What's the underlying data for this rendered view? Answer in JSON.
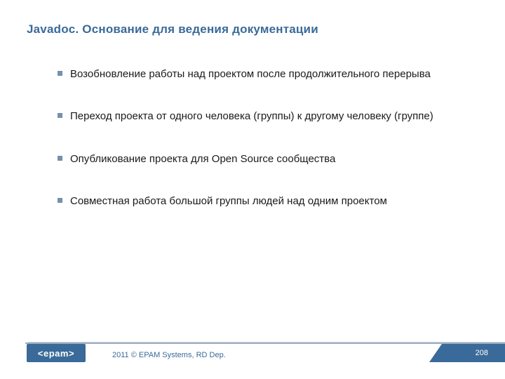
{
  "title": "Javadoc. Основание для ведения документации",
  "bullets": [
    "Возобновление работы над проектом после продолжительного перерыва",
    "Переход проекта от одного человека (группы) к другому человеку (группе)",
    "Опубликование проекта для Open Source сообщества",
    "Совместная работа большой группы людей над одним проектом"
  ],
  "footer": {
    "logo": "<epam>",
    "copyright": "2011 © EPAM Systems, RD Dep.",
    "page": "208"
  }
}
